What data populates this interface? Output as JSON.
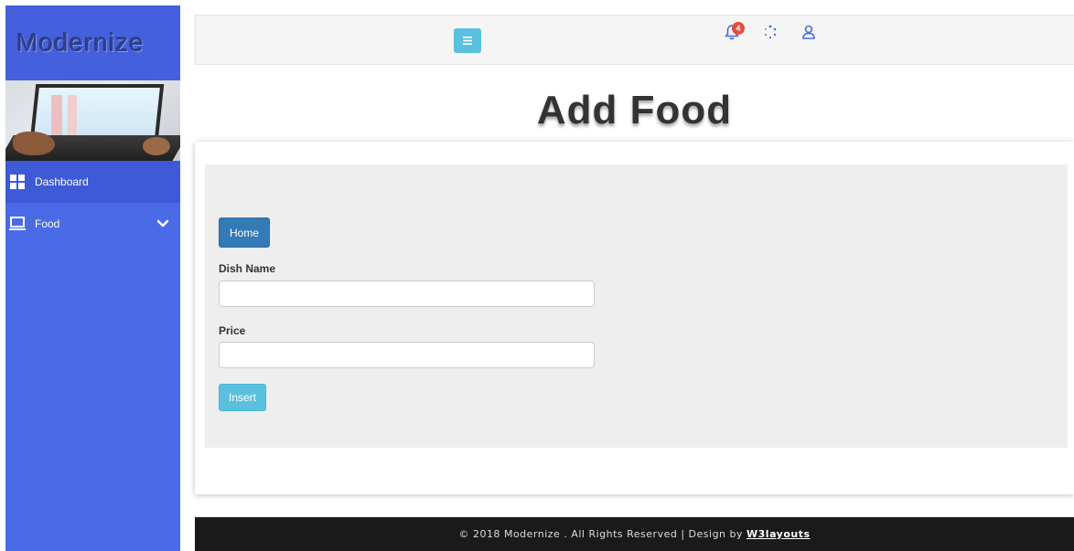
{
  "brand": {
    "name": "Modernize"
  },
  "sidebar": {
    "items": [
      {
        "label": "Dashboard",
        "icon": "grid-icon"
      },
      {
        "label": "Food",
        "icon": "laptop-icon"
      }
    ]
  },
  "topbar": {
    "notification_count": "4"
  },
  "page": {
    "title": "Add Food",
    "home_label": "Home",
    "dish_name_label": "Dish Name",
    "dish_name_value": "",
    "price_label": "Price",
    "price_value": "",
    "insert_label": "Insert"
  },
  "footer": {
    "text": "© 2018 Modernize . All Rights Reserved | Design by",
    "link": "W3layouts"
  },
  "colors": {
    "sidebar": "#4a6ae8",
    "primary_button": "#337ab7",
    "info_button": "#5bc0de",
    "footer_bg": "#1a1a1a"
  }
}
